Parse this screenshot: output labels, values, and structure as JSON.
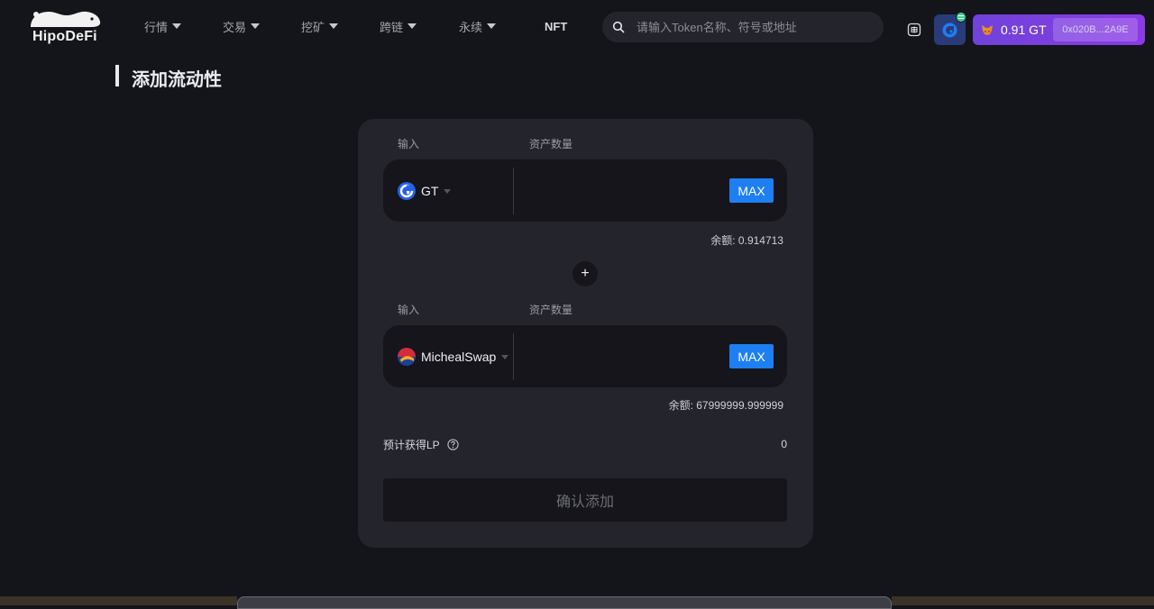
{
  "header": {
    "logo_text": "HipoDeFi",
    "nav": [
      {
        "label": "行情",
        "has_dropdown": true
      },
      {
        "label": "交易",
        "has_dropdown": true
      },
      {
        "label": "挖矿",
        "has_dropdown": true
      },
      {
        "label": "跨链",
        "has_dropdown": true
      },
      {
        "label": "永续",
        "has_dropdown": true
      },
      {
        "label": "NFT",
        "has_dropdown": false
      }
    ],
    "search": {
      "placeholder": "请输入Token名称、符号或地址",
      "value": "",
      "icon": "search-icon"
    },
    "language_icon": "language-icon",
    "chain_icon": "gatechain-icon",
    "wallet": {
      "balance": "0.91 GT",
      "address": "0x020B...2A9E",
      "icon": "metamask-fox-icon"
    }
  },
  "page": {
    "title": "添加流动性"
  },
  "card": {
    "input_a": {
      "label_left": "输入",
      "label_right": "资产数量",
      "token": "GT",
      "token_icon": "gt-token-icon",
      "amount": "",
      "max_label": "MAX",
      "balance_text": "余额: 0.914713"
    },
    "input_b": {
      "label_left": "输入",
      "label_right": "资产数量",
      "token": "MichealSwap",
      "token_icon": "michealswap-token-icon",
      "amount": "",
      "max_label": "MAX",
      "balance_text": "余额: 67999999.999999"
    },
    "plus_symbol": "+",
    "lp_label": "预计获得LP",
    "lp_value": "0",
    "confirm_label": "确认添加"
  },
  "colors": {
    "background": "#14141b",
    "card": "#24242d",
    "accent_blue": "#1d7ff2",
    "wallet_purple": "#7a3fe0"
  }
}
